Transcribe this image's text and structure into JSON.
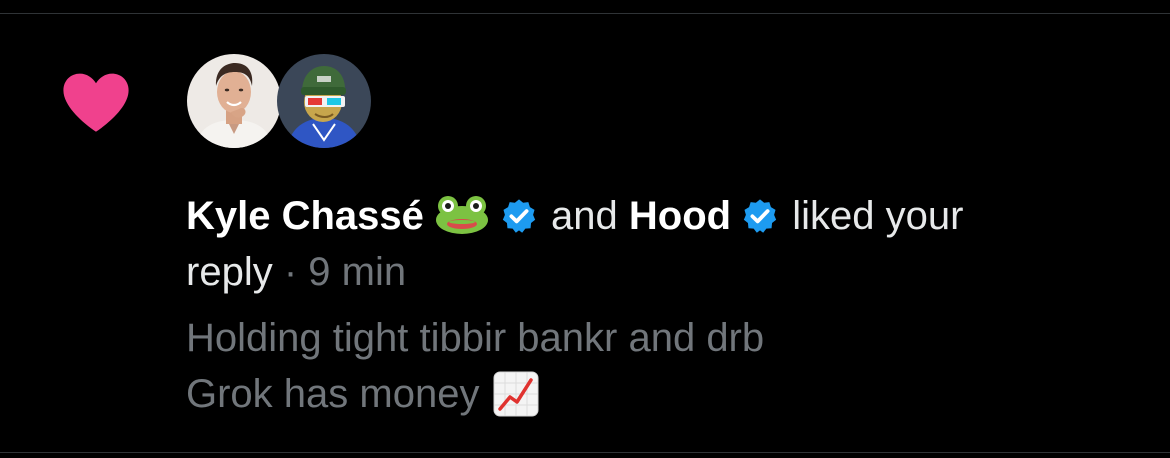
{
  "notification": {
    "type_icon": "heart-icon",
    "colors": {
      "heart": "#f0418d",
      "verified": "#1d9bf0",
      "text_primary": "#e7e9ea",
      "text_secondary": "#71767b",
      "background": "#000000"
    },
    "avatars": [
      {
        "icon": "avatar-kyle-chasse"
      },
      {
        "icon": "avatar-hood"
      }
    ],
    "actor_one_name": "Kyle Chassé",
    "actor_one_emoji": "frog-face-icon",
    "connector": "and",
    "actor_two_name": "Hood",
    "action_text": "liked your",
    "target_text": "reply",
    "separator": "·",
    "time": "9 min",
    "preview_line_one": "Holding tight tibbir bankr and drb",
    "preview_line_two": "Grok has money",
    "preview_emoji": "chart-increasing-icon"
  }
}
